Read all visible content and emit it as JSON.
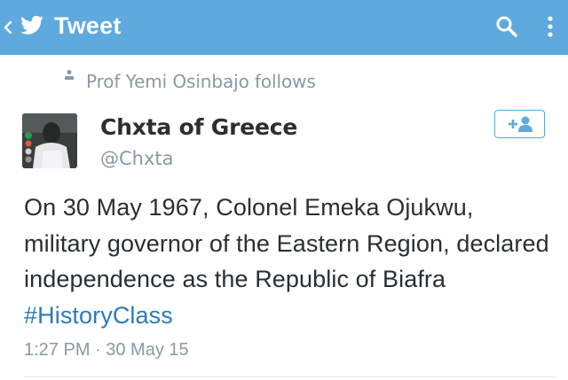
{
  "appbar": {
    "title": "Tweet",
    "background_color": "#5ea9dd",
    "back_icon": "chevron-left-icon",
    "logo_icon": "twitter-bird-icon",
    "search_icon": "search-icon",
    "overflow_icon": "more-vertical-icon"
  },
  "social_context": {
    "icon": "person-icon",
    "text": "Prof Yemi Osinbajo follows"
  },
  "author": {
    "display_name": "Chxta of Greece",
    "handle": "@Chxta",
    "follow_icon": "add-user-icon"
  },
  "tweet": {
    "text": "On 30 May 1967, Colonel Emeka Ojukwu, military governor of the Eastern Region, declared independence as the Republic of Biafra",
    "hashtag": "#HistoryClass",
    "hashtag_color": "#2b7bb9",
    "timestamp": "1:27 PM · 30 May 15"
  }
}
